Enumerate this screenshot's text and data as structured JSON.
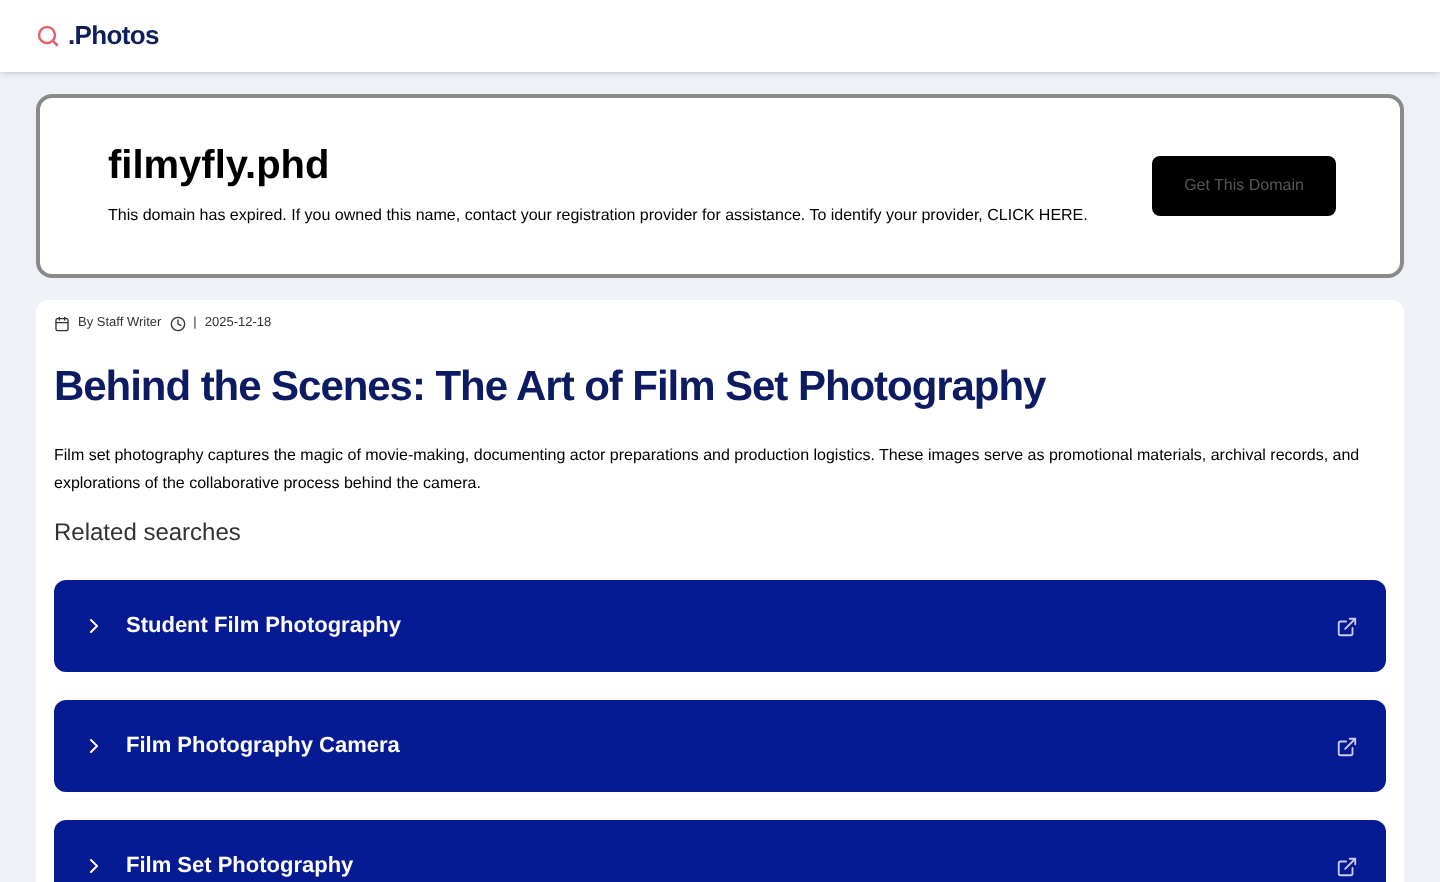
{
  "header": {
    "logo": ".Photos"
  },
  "domain_notice": {
    "domain": "filmyfly.phd",
    "message": "This domain has expired. If you owned this name, contact your registration provider for assistance. To identify your provider, CLICK HERE.",
    "button": "Get This Domain"
  },
  "article": {
    "author": "By Staff Writer",
    "separator": "|",
    "date": "2025-12-18",
    "title": "Behind the Scenes: The Art of Film Set Photography",
    "body": "Film set photography captures the magic of movie-making, documenting actor preparations and production logistics. These images serve as promotional materials, archival records, and explorations of the collaborative process behind the camera.",
    "related_heading": "Related searches",
    "related": [
      {
        "label": "Student Film Photography"
      },
      {
        "label": "Film Photography Camera"
      },
      {
        "label": "Film Set Photography"
      }
    ]
  }
}
